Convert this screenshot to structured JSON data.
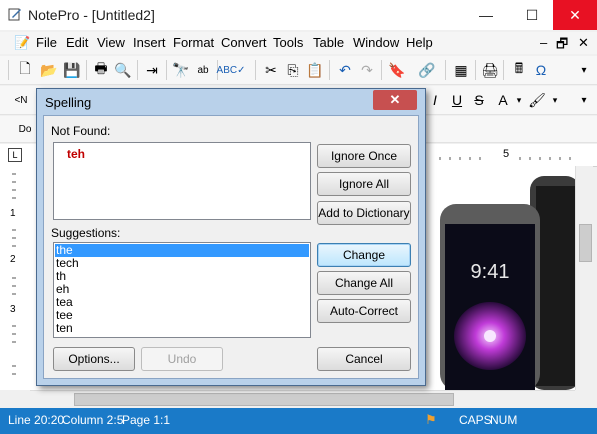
{
  "window": {
    "title": "NotePro - [Untitled2]",
    "minimize": "—",
    "maximize": "☐",
    "close": "✕"
  },
  "menu": [
    "File",
    "Edit",
    "View",
    "Insert",
    "Format",
    "Convert",
    "Tools",
    "Table",
    "Window",
    "Help"
  ],
  "mdi_controls": {
    "minimize": "–",
    "restore": "🗗",
    "close": "✕"
  },
  "ruler": {
    "mark": "5"
  },
  "vruler": {
    "marks": [
      "1",
      "2",
      "3"
    ]
  },
  "dialog": {
    "title": "Spelling",
    "close": "✕",
    "not_found_label": "Not Found:",
    "not_found_word": "teh",
    "suggestions_label": "Suggestions:",
    "suggestions": [
      "the",
      "tech",
      "th",
      "eh",
      "tea",
      "tee",
      "ten"
    ],
    "selected_suggestion": "the",
    "buttons": {
      "ignore_once": "Ignore Once",
      "ignore_all": "Ignore All",
      "add_to_dictionary": "Add to Dictionary",
      "change": "Change",
      "change_all": "Change All",
      "auto_correct": "Auto-Correct",
      "options": "Options...",
      "undo": "Undo",
      "cancel": "Cancel"
    }
  },
  "status": {
    "line": "Line 20:20",
    "column": "Column 2:5",
    "page": "Page 1:1",
    "caps": "CAPS",
    "num": "NUM"
  },
  "colors": {
    "status_bar": "#1a7ac8",
    "dialog_frame": "#b9d1ea",
    "not_found_word": "#c00000",
    "selection": "#3399ff"
  }
}
